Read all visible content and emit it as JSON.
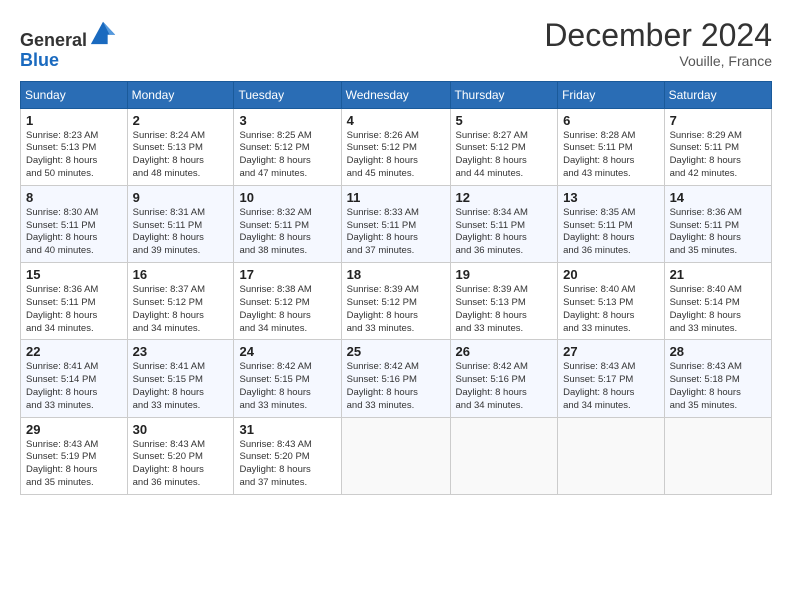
{
  "header": {
    "logo_line1": "General",
    "logo_line2": "Blue",
    "month": "December 2024",
    "location": "Vouille, France"
  },
  "days_of_week": [
    "Sunday",
    "Monday",
    "Tuesday",
    "Wednesday",
    "Thursday",
    "Friday",
    "Saturday"
  ],
  "weeks": [
    [
      {
        "day": "1",
        "info": "Sunrise: 8:23 AM\nSunset: 5:13 PM\nDaylight: 8 hours\nand 50 minutes."
      },
      {
        "day": "2",
        "info": "Sunrise: 8:24 AM\nSunset: 5:13 PM\nDaylight: 8 hours\nand 48 minutes."
      },
      {
        "day": "3",
        "info": "Sunrise: 8:25 AM\nSunset: 5:12 PM\nDaylight: 8 hours\nand 47 minutes."
      },
      {
        "day": "4",
        "info": "Sunrise: 8:26 AM\nSunset: 5:12 PM\nDaylight: 8 hours\nand 45 minutes."
      },
      {
        "day": "5",
        "info": "Sunrise: 8:27 AM\nSunset: 5:12 PM\nDaylight: 8 hours\nand 44 minutes."
      },
      {
        "day": "6",
        "info": "Sunrise: 8:28 AM\nSunset: 5:11 PM\nDaylight: 8 hours\nand 43 minutes."
      },
      {
        "day": "7",
        "info": "Sunrise: 8:29 AM\nSunset: 5:11 PM\nDaylight: 8 hours\nand 42 minutes."
      }
    ],
    [
      {
        "day": "8",
        "info": "Sunrise: 8:30 AM\nSunset: 5:11 PM\nDaylight: 8 hours\nand 40 minutes."
      },
      {
        "day": "9",
        "info": "Sunrise: 8:31 AM\nSunset: 5:11 PM\nDaylight: 8 hours\nand 39 minutes."
      },
      {
        "day": "10",
        "info": "Sunrise: 8:32 AM\nSunset: 5:11 PM\nDaylight: 8 hours\nand 38 minutes."
      },
      {
        "day": "11",
        "info": "Sunrise: 8:33 AM\nSunset: 5:11 PM\nDaylight: 8 hours\nand 37 minutes."
      },
      {
        "day": "12",
        "info": "Sunrise: 8:34 AM\nSunset: 5:11 PM\nDaylight: 8 hours\nand 36 minutes."
      },
      {
        "day": "13",
        "info": "Sunrise: 8:35 AM\nSunset: 5:11 PM\nDaylight: 8 hours\nand 36 minutes."
      },
      {
        "day": "14",
        "info": "Sunrise: 8:36 AM\nSunset: 5:11 PM\nDaylight: 8 hours\nand 35 minutes."
      }
    ],
    [
      {
        "day": "15",
        "info": "Sunrise: 8:36 AM\nSunset: 5:11 PM\nDaylight: 8 hours\nand 34 minutes."
      },
      {
        "day": "16",
        "info": "Sunrise: 8:37 AM\nSunset: 5:12 PM\nDaylight: 8 hours\nand 34 minutes."
      },
      {
        "day": "17",
        "info": "Sunrise: 8:38 AM\nSunset: 5:12 PM\nDaylight: 8 hours\nand 34 minutes."
      },
      {
        "day": "18",
        "info": "Sunrise: 8:39 AM\nSunset: 5:12 PM\nDaylight: 8 hours\nand 33 minutes."
      },
      {
        "day": "19",
        "info": "Sunrise: 8:39 AM\nSunset: 5:13 PM\nDaylight: 8 hours\nand 33 minutes."
      },
      {
        "day": "20",
        "info": "Sunrise: 8:40 AM\nSunset: 5:13 PM\nDaylight: 8 hours\nand 33 minutes."
      },
      {
        "day": "21",
        "info": "Sunrise: 8:40 AM\nSunset: 5:14 PM\nDaylight: 8 hours\nand 33 minutes."
      }
    ],
    [
      {
        "day": "22",
        "info": "Sunrise: 8:41 AM\nSunset: 5:14 PM\nDaylight: 8 hours\nand 33 minutes."
      },
      {
        "day": "23",
        "info": "Sunrise: 8:41 AM\nSunset: 5:15 PM\nDaylight: 8 hours\nand 33 minutes."
      },
      {
        "day": "24",
        "info": "Sunrise: 8:42 AM\nSunset: 5:15 PM\nDaylight: 8 hours\nand 33 minutes."
      },
      {
        "day": "25",
        "info": "Sunrise: 8:42 AM\nSunset: 5:16 PM\nDaylight: 8 hours\nand 33 minutes."
      },
      {
        "day": "26",
        "info": "Sunrise: 8:42 AM\nSunset: 5:16 PM\nDaylight: 8 hours\nand 34 minutes."
      },
      {
        "day": "27",
        "info": "Sunrise: 8:43 AM\nSunset: 5:17 PM\nDaylight: 8 hours\nand 34 minutes."
      },
      {
        "day": "28",
        "info": "Sunrise: 8:43 AM\nSunset: 5:18 PM\nDaylight: 8 hours\nand 35 minutes."
      }
    ],
    [
      {
        "day": "29",
        "info": "Sunrise: 8:43 AM\nSunset: 5:19 PM\nDaylight: 8 hours\nand 35 minutes."
      },
      {
        "day": "30",
        "info": "Sunrise: 8:43 AM\nSunset: 5:20 PM\nDaylight: 8 hours\nand 36 minutes."
      },
      {
        "day": "31",
        "info": "Sunrise: 8:43 AM\nSunset: 5:20 PM\nDaylight: 8 hours\nand 37 minutes."
      },
      null,
      null,
      null,
      null
    ]
  ]
}
